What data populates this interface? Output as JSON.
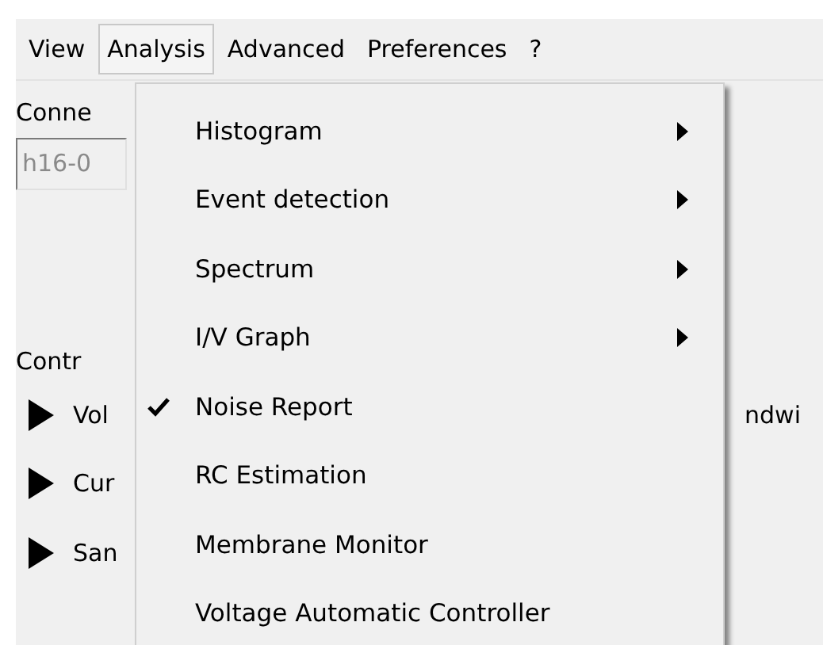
{
  "menu_bar": [
    {
      "label": "View",
      "selected": false
    },
    {
      "label": "Analysis",
      "selected": true
    },
    {
      "label": "Advanced",
      "selected": false
    },
    {
      "label": "Preferences",
      "selected": false
    },
    {
      "label": "?",
      "selected": false
    }
  ],
  "connection": {
    "label": "Conne",
    "field_value": "h16-0"
  },
  "controls": {
    "label": "Contr",
    "rows": [
      {
        "label": "Vol",
        "trailing": "ndwi"
      },
      {
        "label": "Cur"
      },
      {
        "label": "San"
      }
    ]
  },
  "dropdown": [
    {
      "label": "Histogram",
      "has_submenu": true,
      "checked": false
    },
    {
      "label": "Event detection",
      "has_submenu": true,
      "checked": false
    },
    {
      "label": "Spectrum",
      "has_submenu": true,
      "checked": false
    },
    {
      "label": "I/V Graph",
      "has_submenu": true,
      "checked": false
    },
    {
      "label": "Noise Report",
      "has_submenu": false,
      "checked": true
    },
    {
      "label": "RC Estimation",
      "has_submenu": false,
      "checked": false
    },
    {
      "label": "Membrane Monitor",
      "has_submenu": false,
      "checked": false
    },
    {
      "label": "Voltage Automatic Controller",
      "has_submenu": false,
      "checked": false
    }
  ]
}
